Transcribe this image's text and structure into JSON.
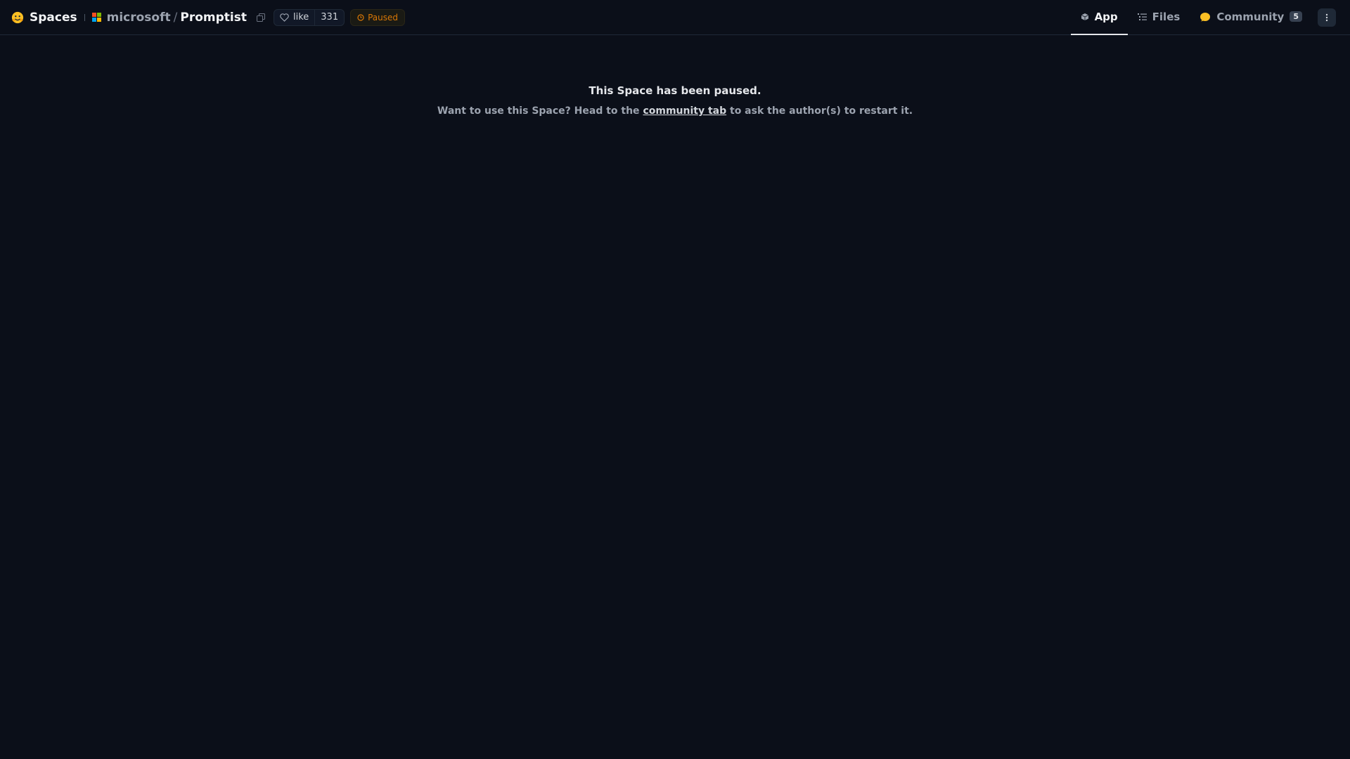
{
  "header": {
    "brand_label": "Spaces",
    "repo_owner": "microsoft",
    "repo_separator": "/",
    "repo_name": "Promptist",
    "like_label": "like",
    "like_count": "331",
    "status_label": "Paused",
    "tabs": [
      {
        "label": "App",
        "icon": "cube-icon",
        "active": true
      },
      {
        "label": "Files",
        "icon": "files-icon",
        "active": false
      },
      {
        "label": "Community",
        "icon": "community-icon",
        "active": false,
        "count": "5"
      }
    ]
  },
  "main": {
    "title": "This Space has been paused.",
    "message_before": "Want to use this Space? Head to the",
    "message_link": "community tab",
    "message_after": "to ask the author(s) to restart it."
  },
  "colors": {
    "background": "#0b0f19",
    "status_accent": "#d97706",
    "brand_yellow": "#fbbf24"
  }
}
